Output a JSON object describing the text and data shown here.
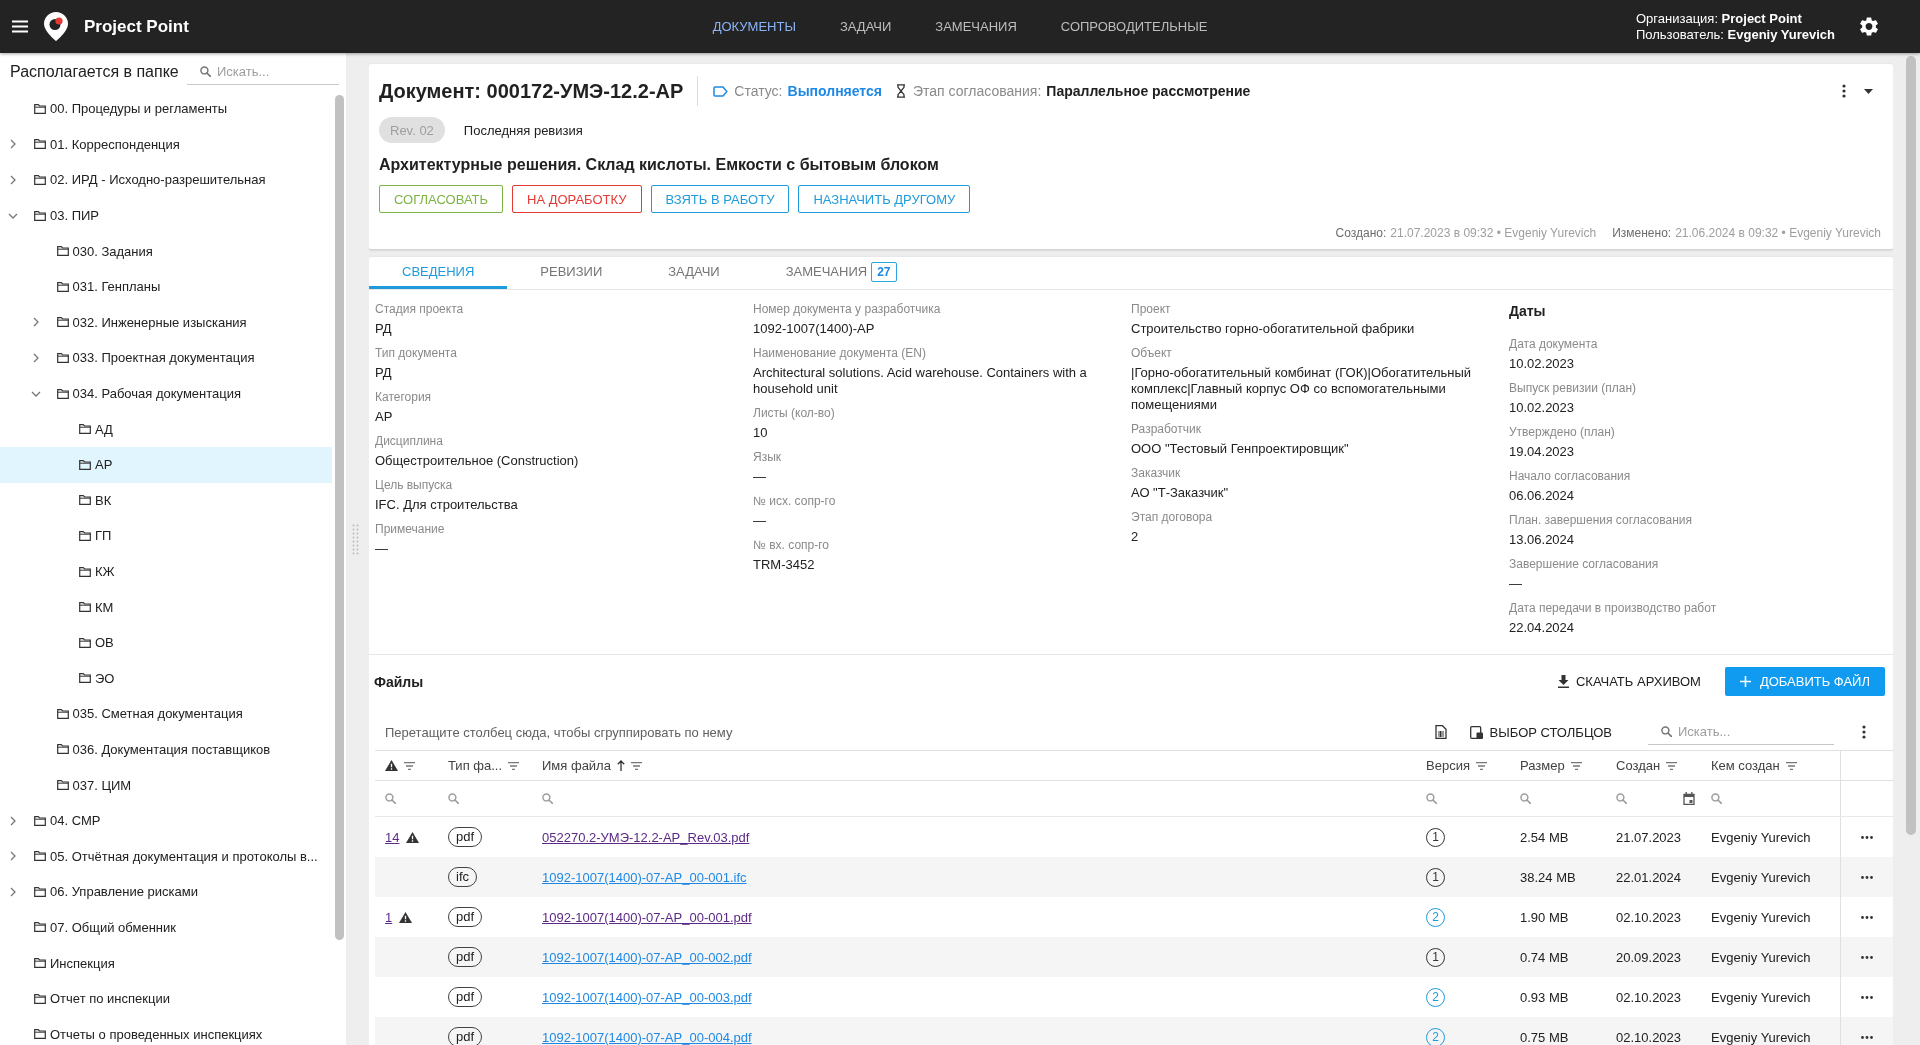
{
  "app": {
    "title": "Project Point"
  },
  "nav": [
    {
      "label": "ДОКУМЕНТЫ",
      "selected": true
    },
    {
      "label": "ЗАДАЧИ",
      "selected": false
    },
    {
      "label": "ЗАМЕЧАНИЯ",
      "selected": false
    },
    {
      "label": "СОПРОВОДИТЕЛЬНЫЕ",
      "selected": false
    }
  ],
  "account": {
    "organization": "Организация: **Project Point**",
    "user": "Пользователь: **Evgeniy Yurevich**"
  },
  "sidebar": {
    "title": "Располагается в папке",
    "search": {
      "placeholder": "Искать..."
    },
    "items": [
      {
        "label": "00. Процедуры и регламенты",
        "selected": false
      },
      {
        "label": "01. Корреспонденция",
        "expanded": false,
        "selected": false
      },
      {
        "label": "02. ИРД - Исходно-разрешительная",
        "expanded": false,
        "selected": false
      },
      {
        "label": "03. ПИР",
        "expanded": true,
        "selected": false,
        "children": [
          {
            "label": "030. Задания",
            "selected": false
          },
          {
            "label": "031. Генпланы",
            "selected": false
          },
          {
            "label": "032. Инженерные изыскания",
            "expanded": false,
            "selected": false
          },
          {
            "label": "033. Проектная документация",
            "expanded": false,
            "selected": false
          },
          {
            "label": "034. Рабочая документация",
            "expanded": true,
            "selected": false,
            "children": [
              {
                "label": "АД",
                "selected": false
              },
              {
                "label": "АР",
                "selected": true
              },
              {
                "label": "ВК",
                "selected": false
              },
              {
                "label": "ГП",
                "selected": false
              },
              {
                "label": "КЖ",
                "selected": false
              },
              {
                "label": "КМ",
                "selected": false
              },
              {
                "label": "ОВ",
                "selected": false
              },
              {
                "label": "ЭО",
                "selected": false
              }
            ]
          },
          {
            "label": "035. Сметная документация",
            "selected": false
          },
          {
            "label": "036. Документация поставщиков",
            "selected": false
          },
          {
            "label": "037. ЦИМ",
            "selected": false
          }
        ]
      },
      {
        "label": "04. СМР",
        "expanded": false,
        "selected": false
      },
      {
        "label": "05. Отчётная документация и протоколы в...",
        "expanded": false,
        "selected": false
      },
      {
        "label": "06. Управление рисками",
        "expanded": false,
        "selected": false
      },
      {
        "label": "07. Общий обменник",
        "selected": false
      },
      {
        "label": "Инспекция",
        "selected": false
      },
      {
        "label": "Отчет по инспекции",
        "selected": false
      },
      {
        "label": "Отчеты о проведенных инспекциях",
        "selected": false
      }
    ]
  },
  "document": {
    "title": "Документ: 000172-УМЭ-12.2-АР",
    "status_label": "Статус:",
    "status": "Выполняется",
    "stage_label": "Этап согласования:",
    "stage": "Параллельное рассмотрение",
    "revision": "Rev. 02",
    "revision_note": "Последняя ревизия",
    "name": "Архитектурные решения. Склад кислоты. Емкости с бытовым блоком",
    "actions": [
      {
        "label": "СОГЛАСОВАТЬ",
        "color": "#7cb342"
      },
      {
        "label": "НА ДОРАБОТКУ",
        "color": "#e53935"
      },
      {
        "label": "ВЗЯТЬ В РАБОТУ",
        "color": "#1e9bdc"
      },
      {
        "label": "НАЗНАЧИТЬ ДРУГОМУ",
        "color": "#1e9bdc"
      }
    ],
    "created": {
      "label": "Создано:",
      "value": "21.07.2023 в 09:32 • Evgeniy Yurevich"
    },
    "modified": {
      "label": "Изменено:",
      "value": "21.06.2024 в 09:32 • Evgeniy Yurevich"
    }
  },
  "tabs": [
    {
      "label": "СВЕДЕНИЯ",
      "selected": true
    },
    {
      "label": "РЕВИЗИИ",
      "selected": false
    },
    {
      "label": "ЗАДАЧИ",
      "selected": false
    },
    {
      "label": "ЗАМЕЧАНИЯ",
      "selected": false,
      "badge": "27"
    }
  ],
  "details": {
    "columns": [
      {
        "fields": [
          {
            "label": "Стадия проекта",
            "value": "РД"
          },
          {
            "label": "Тип документа",
            "value": "РД"
          },
          {
            "label": "Категория",
            "value": "АР"
          },
          {
            "label": "Дисциплина",
            "value": "Общестроительное (Construction)"
          },
          {
            "label": "Цель выпуска",
            "value": "IFC. Для строительства"
          },
          {
            "label": "Примечание",
            "value": "—"
          }
        ]
      },
      {
        "fields": [
          {
            "label": "Номер документа у разработчика",
            "value": "1092-1007(1400)-АР"
          },
          {
            "label": "Наименование документа (EN)",
            "value": "Architectural solutions. Acid warehouse. Containers with a household unit"
          },
          {
            "label": "Листы (кол-во)",
            "value": "10"
          },
          {
            "label": "Язык",
            "value": "—"
          },
          {
            "label": "№ исх. сопр-го",
            "value": "—"
          },
          {
            "label": "№ вх. сопр-го",
            "value": "TRM-3452"
          }
        ]
      },
      {
        "fields": [
          {
            "label": "Проект",
            "value": "Строительство горно-обогатительной фабрики"
          },
          {
            "label": "Объект",
            "value": "|Горно-обогатительный комбинат (ГОК)|Обогатительный комплекс|Главный корпус ОФ со вспомогательными помещениями"
          },
          {
            "label": "Разработчик",
            "value": "ООО \"Тестовый Генпроектировщик\""
          },
          {
            "label": "Заказчик",
            "value": "АО \"Т-Заказчик\""
          },
          {
            "label": "Этап договора",
            "value": "2"
          }
        ]
      },
      {
        "title": "Даты",
        "fields": [
          {
            "label": "Дата документа",
            "value": "10.02.2023"
          },
          {
            "label": "Выпуск ревизии (план)",
            "value": "10.02.2023"
          },
          {
            "label": "Утверждено (план)",
            "value": "19.04.2023"
          },
          {
            "label": "Начало согласования",
            "value": "06.06.2024"
          },
          {
            "label": "План. завершения согласования",
            "value": "13.06.2024"
          },
          {
            "label": "Завершение согласования",
            "value": "—"
          },
          {
            "label": "Дата передачи в производство работ",
            "value": "22.04.2024"
          }
        ]
      }
    ]
  },
  "files": {
    "title": "Файлы",
    "download": "СКАЧАТЬ АРХИВОМ",
    "add": "ДОБАВИТЬ ФАЙЛ",
    "group_hint": "Перетащите столбец сюда, чтобы сгруппировать по нему",
    "column_chooser": "ВЫБОР СТОЛБЦОВ",
    "search": {
      "placeholder": "Искать..."
    },
    "columns": [
      {
        "kind": "warning",
        "sorted": false
      },
      {
        "kind": "text",
        "label": "Тип фа...",
        "sorted": false
      },
      {
        "kind": "text",
        "label": "Имя файла",
        "sorted": true
      },
      {
        "kind": "text",
        "label": "Версия",
        "sorted": false
      },
      {
        "kind": "text",
        "label": "Размер",
        "sorted": false
      },
      {
        "kind": "date",
        "label": "Создан",
        "sorted": false
      },
      {
        "kind": "text",
        "label": "Кем создан",
        "sorted": false
      }
    ],
    "rows": [
      {
        "comments": "14",
        "warning": true,
        "type": "pdf",
        "file": "052270.2-УМЭ-12.2-АР_Rev.03.pdf",
        "visited": true,
        "version": "1",
        "version_highlighted": false,
        "size": "2.54 MB",
        "created": "21.07.2023",
        "author": "Evgeniy Yurevich"
      },
      {
        "warning": false,
        "type": "ifc",
        "file": "1092-1007(1400)-07-АР_00-001.ifc",
        "visited": false,
        "version": "1",
        "version_highlighted": false,
        "size": "38.24 MB",
        "created": "22.01.2024",
        "author": "Evgeniy Yurevich"
      },
      {
        "comments": "1",
        "warning": true,
        "type": "pdf",
        "file": "1092-1007(1400)-07-АР_00-001.pdf",
        "visited": true,
        "version": "2",
        "version_highlighted": true,
        "size": "1.90 MB",
        "created": "02.10.2023",
        "author": "Evgeniy Yurevich"
      },
      {
        "warning": false,
        "type": "pdf",
        "file": "1092-1007(1400)-07-АР_00-002.pdf",
        "visited": false,
        "version": "1",
        "version_highlighted": false,
        "size": "0.74 MB",
        "created": "20.09.2023",
        "author": "Evgeniy Yurevich"
      },
      {
        "warning": false,
        "type": "pdf",
        "file": "1092-1007(1400)-07-АР_00-003.pdf",
        "visited": false,
        "version": "2",
        "version_highlighted": true,
        "size": "0.93 MB",
        "created": "02.10.2023",
        "author": "Evgeniy Yurevich"
      },
      {
        "warning": false,
        "type": "pdf",
        "file": "1092-1007(1400)-07-АР_00-004.pdf",
        "visited": false,
        "version": "2",
        "version_highlighted": true,
        "size": "0.75 MB",
        "created": "02.10.2023",
        "author": "Evgeniy Yurevich"
      }
    ]
  }
}
